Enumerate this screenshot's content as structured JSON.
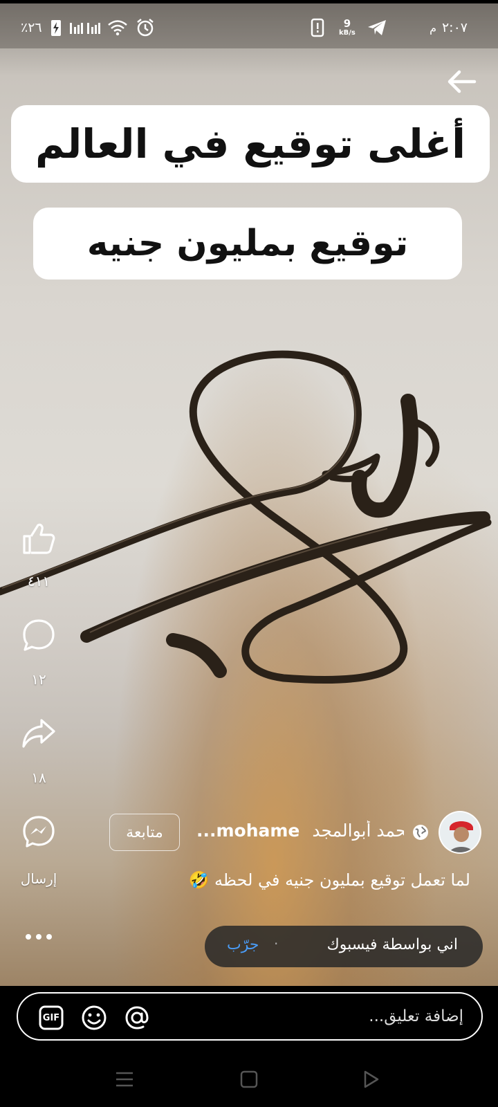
{
  "status_bar": {
    "time": "٢:٠٧",
    "time_suffix": "م",
    "battery": "٪٢٦",
    "net_speed_value": "9",
    "net_speed_unit": "kB/s"
  },
  "overlay": {
    "title_line_1": "أغلى توقيع في العالم",
    "title_line_2": "توقيع بمليون جنيه"
  },
  "actions": {
    "like_count": "٤١١",
    "comment_count": "١٢",
    "share_count": "١٨",
    "send_label": "إرسال"
  },
  "post": {
    "author_arabic": "محمد أبوالمجد",
    "author_latin": "...mohame",
    "follow_label": "متابعة",
    "caption": "لما تعمل توقيع بمليون جنيه في لحظه 🤣"
  },
  "try_banner": {
    "text": "اني بواسطة فيسبوك",
    "link": "جرّب"
  },
  "comment": {
    "placeholder": "إضافة تعليق...",
    "gif_label": "GIF"
  },
  "icons": [
    "back-arrow-icon",
    "like-icon",
    "comment-icon",
    "share-icon",
    "messenger-icon",
    "more-icon",
    "globe-icon",
    "gif-icon",
    "emoji-icon",
    "mention-icon",
    "recent-apps-icon",
    "home-icon",
    "nav-back-icon"
  ]
}
